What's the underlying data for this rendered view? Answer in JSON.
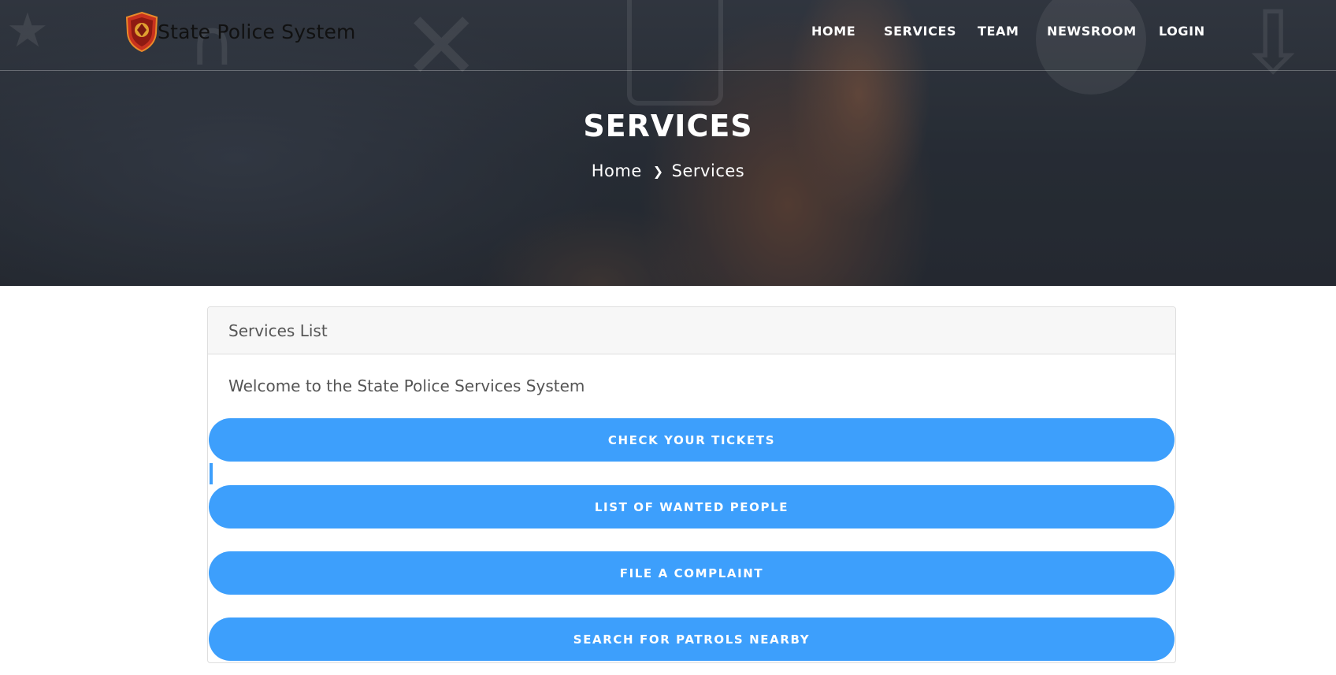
{
  "brand": {
    "name": "State Police System",
    "logo_icon": "police-shield-logo-icon"
  },
  "nav": {
    "items": [
      {
        "label": "HOME"
      },
      {
        "label": "SERVICES"
      },
      {
        "label": "TEAM"
      },
      {
        "label": "NEWSROOM"
      },
      {
        "label": "LOGIN"
      }
    ]
  },
  "hero": {
    "title": "SERVICES",
    "breadcrumb": {
      "home": "Home",
      "separator_icon": "chevron-right-icon",
      "current": "Services"
    }
  },
  "card": {
    "header": "Services List",
    "welcome": "Welcome to the State Police Services System",
    "buttons": [
      {
        "label": "CHECK YOUR TICKETS"
      },
      {
        "label": "LIST OF WANTED PEOPLE"
      },
      {
        "label": "FILE A COMPLAINT"
      },
      {
        "label": "SEARCH FOR PATROLS NEARBY"
      }
    ]
  },
  "colors": {
    "accent": "#3d9ffc",
    "hero_text": "#ffffff",
    "body_text": "#555555",
    "header_bg": "#f7f7f7"
  }
}
